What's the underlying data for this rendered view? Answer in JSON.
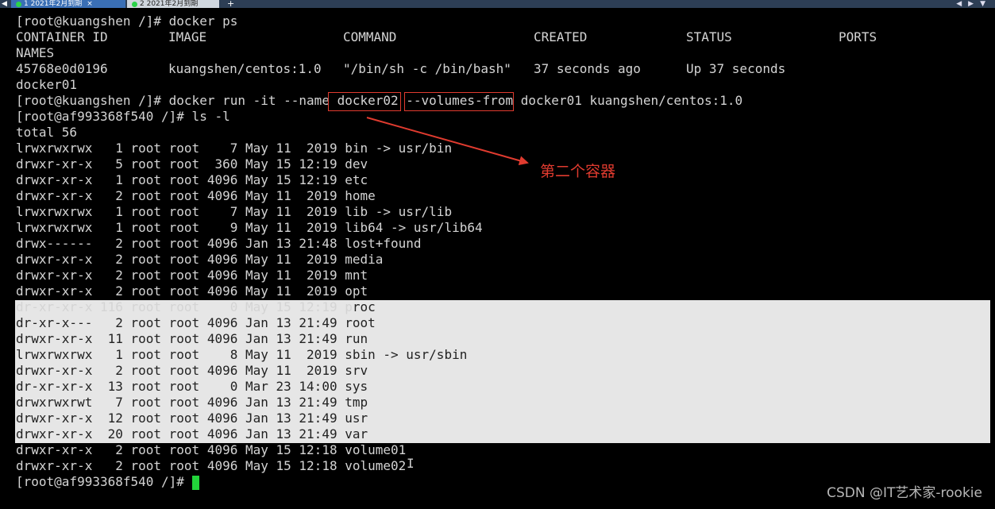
{
  "tabs": {
    "tab1_label": "1 2021年2月到期",
    "tab2_label": "2 2021年2月到期",
    "close_glyph": "×",
    "add_glyph": "+"
  },
  "terminal": {
    "cmd_ps": "[root@kuangshen /]# docker ps",
    "headers": [
      "CONTAINER ID",
      "IMAGE",
      "COMMAND",
      "CREATED",
      "STATUS",
      "PORTS"
    ],
    "names_header": "NAMES",
    "container_row": [
      "45768e0d0196",
      "kuangshen/centos:1.0",
      "\"/bin/sh -c /bin/bash\"",
      "37 seconds ago",
      "Up 37 seconds"
    ],
    "container_name": "docker01",
    "run_prompt": "[root@kuangshen /]# docker run -it --name ",
    "run_name": "docker02",
    "run_flag": "--volumes-from",
    "run_tail": " docker01 kuangshen/centos:1.0",
    "ls_cmd": "[root@af993368f540 /]# ls -l",
    "total": "total 56",
    "listing": [
      "lrwxrwxrwx   1 root root    7 May 11  2019 bin -> usr/bin",
      "drwxr-xr-x   5 root root  360 May 15 12:19 dev",
      "drwxr-xr-x   1 root root 4096 May 15 12:19 etc",
      "drwxr-xr-x   2 root root 4096 May 11  2019 home",
      "lrwxrwxrwx   1 root root    7 May 11  2019 lib -> usr/lib",
      "lrwxrwxrwx   1 root root    9 May 11  2019 lib64 -> usr/lib64",
      "drwx------   2 root root 4096 Jan 13 21:48 lost+found",
      "drwxr-xr-x   2 root root 4096 May 11  2019 media",
      "drwxr-xr-x   2 root root 4096 May 11  2019 mnt",
      "drwxr-xr-x   2 root root 4096 May 11  2019 opt"
    ],
    "proc_line_head": "dr-xr-xr-x 116 root root    0 May 15 12:19 p",
    "proc_line_tail": "roc",
    "selected_listing": [
      "dr-xr-x---   2 root root 4096 Jan 13 21:49 root",
      "drwxr-xr-x  11 root root 4096 Jan 13 21:49 run",
      "lrwxrwxrwx   1 root root    8 May 11  2019 sbin -> usr/sbin",
      "drwxr-xr-x   2 root root 4096 May 11  2019 srv",
      "dr-xr-xr-x  13 root root    0 Mar 23 14:00 sys",
      "drwxrwxrwt   7 root root 4096 Jan 13 21:49 tmp",
      "drwxr-xr-x  12 root root 4096 Jan 13 21:49 usr",
      "drwxr-xr-x  20 root root 4096 Jan 13 21:49 var"
    ],
    "tail_listing": [
      "drwxr-xr-x   2 root root 4096 May 15 12:18 volume01",
      "drwxr-xr-x   2 root root 4096 May 15 12:18 volume02"
    ],
    "final_prompt": "[root@af993368f540 /]# "
  },
  "annotation": {
    "text": "第二个容器",
    "color": "#e03b2f"
  },
  "watermark": "CSDN @IT艺术家-rookie",
  "colors": {
    "background": "#000000",
    "text": "#d4d4d4",
    "selection": "#e6e6e6",
    "cursor": "#22d33a",
    "tab_active": "#3a6fb5"
  }
}
